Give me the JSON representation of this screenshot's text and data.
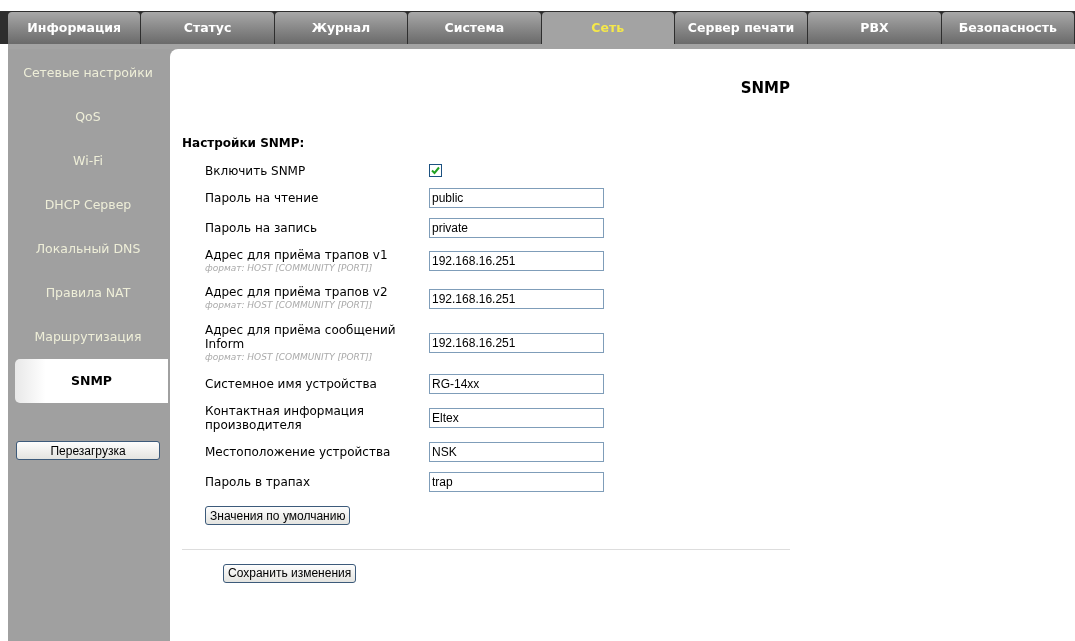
{
  "tabs": [
    {
      "label": "Информация",
      "selected": false
    },
    {
      "label": "Статус",
      "selected": false
    },
    {
      "label": "Журнал",
      "selected": false
    },
    {
      "label": "Система",
      "selected": false
    },
    {
      "label": "Сеть",
      "selected": true
    },
    {
      "label": "Сервер печати",
      "selected": false
    },
    {
      "label": "PBX",
      "selected": false
    },
    {
      "label": "Безопасность",
      "selected": false
    }
  ],
  "sidebar": {
    "items": [
      {
        "label": "Сетевые настройки",
        "selected": false
      },
      {
        "label": "QoS",
        "selected": false
      },
      {
        "label": "Wi-Fi",
        "selected": false
      },
      {
        "label": "DHCP Сервер",
        "selected": false
      },
      {
        "label": "Локальный DNS",
        "selected": false
      },
      {
        "label": "Правила NAT",
        "selected": false
      },
      {
        "label": "Маршрутизация",
        "selected": false
      },
      {
        "label": "SNMP",
        "selected": true
      }
    ],
    "reboot_button": "Перезагрузка"
  },
  "page_title": "SNMP",
  "section_title": "Настройки SNMP:",
  "fields": [
    {
      "kind": "checkbox",
      "label": "Включить SNMP",
      "checked": true
    },
    {
      "kind": "text",
      "label": "Пароль на чтение",
      "value": "public"
    },
    {
      "kind": "text",
      "label": "Пароль на запись",
      "value": "private"
    },
    {
      "kind": "text",
      "label": "Адрес для приёма трапов v1",
      "hint": "формат: HOST [COMMUNITY [PORT]]",
      "value": "192.168.16.251"
    },
    {
      "kind": "text",
      "label": "Адрес для приёма трапов v2",
      "hint": "формат: HOST [COMMUNITY [PORT]]",
      "value": "192.168.16.251"
    },
    {
      "kind": "text",
      "label": "Адрес для приёма сообщений Inform",
      "hint": "формат: HOST [COMMUNITY [PORT]]",
      "value": "192.168.16.251"
    },
    {
      "kind": "text",
      "label": "Системное имя устройства",
      "value": "RG-14xx"
    },
    {
      "kind": "text",
      "label": "Контактная информация производителя",
      "value": "Eltex"
    },
    {
      "kind": "text",
      "label": "Местоположение устройства",
      "value": "NSK"
    },
    {
      "kind": "text",
      "label": "Пароль в трапах",
      "value": "trap"
    }
  ],
  "defaults_button": "Значения по умолчанию",
  "save_button": "Сохранить изменения"
}
